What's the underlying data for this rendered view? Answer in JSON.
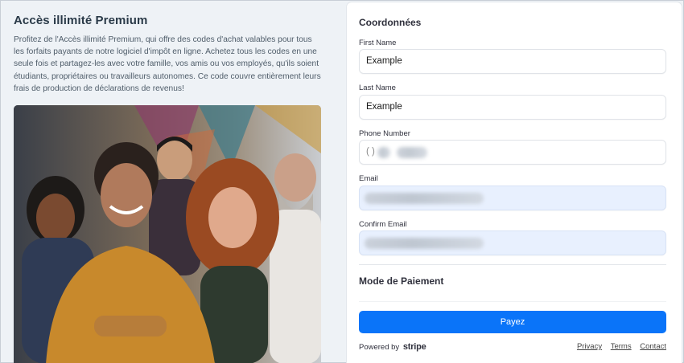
{
  "product": {
    "title": "Accès illimité Premium",
    "description": "Profitez de l'Accès illimité Premium, qui offre des codes d'achat valables pour tous les forfaits payants de notre logiciel d'impôt en ligne. Achetez tous les codes en une seule fois et partagez-les avec votre famille, vos amis ou vos employés, qu'ils soient étudiants, propriétaires ou travailleurs autonomes. Ce code couvre entièrement leurs frais de production de déclarations de revenus!"
  },
  "form": {
    "section_title": "Coordonnées",
    "fields": [
      {
        "label": "First Name",
        "value": "Example"
      },
      {
        "label": "Last Name",
        "value": "Example"
      },
      {
        "label": "Phone Number",
        "value": "( )"
      },
      {
        "label": "Email",
        "value": ""
      },
      {
        "label": "Confirm Email",
        "value": ""
      }
    ],
    "payment_title": "Mode de Paiement",
    "pay_button": "Payez"
  },
  "footer": {
    "powered_by": "Powered by",
    "brand": "stripe",
    "links": [
      "Privacy",
      "Terms",
      "Contact"
    ]
  },
  "colors": {
    "accent": "#0a74f9",
    "autofill": "#e8f0fe"
  }
}
